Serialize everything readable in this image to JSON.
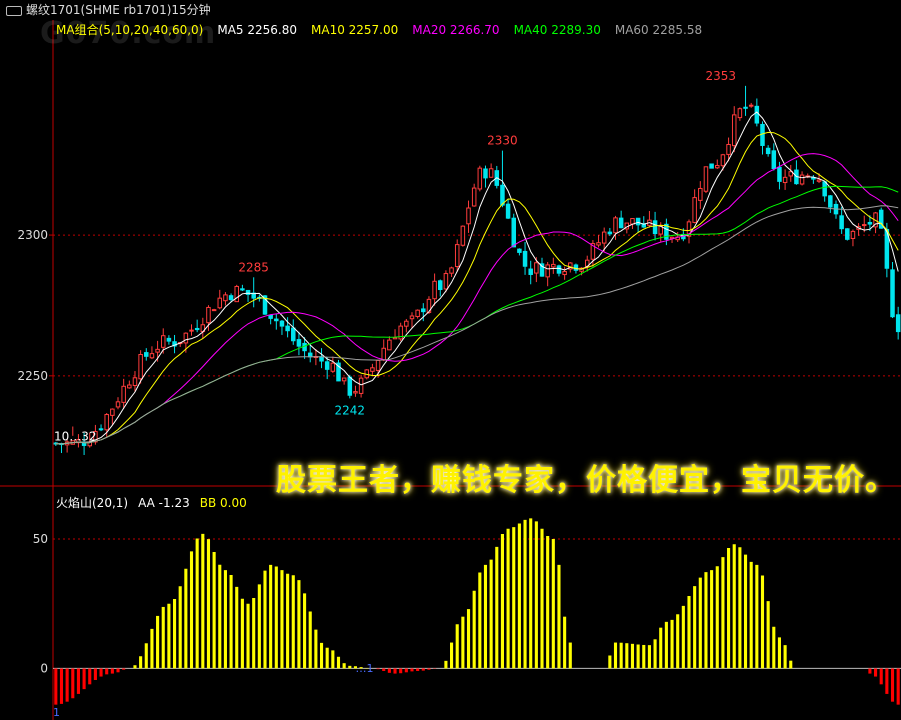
{
  "title": "螺纹1701(SHME rb1701)15分钟",
  "watermark": "G070.com",
  "banner": "股票王者，赚钱专家，价格便宜，宝贝无价。",
  "ma_legend": {
    "group": "MA组合(5,10,20,40,60,0)",
    "ma5": "MA5 2256.80",
    "ma10": "MA10 2257.00",
    "ma20": "MA20 2266.70",
    "ma40": "MA40 2289.30",
    "ma60": "MA60 2285.58"
  },
  "indicator_legend": {
    "name": "火焰山(20,1)",
    "aa": "AA  -1.23",
    "bb": "BB  0.00"
  },
  "colors": {
    "up": "#ff3c3c",
    "down": "#00e5ee",
    "ma5": "#ffffff",
    "ma10": "#ffff00",
    "ma20": "#ff00ff",
    "ma40": "#00ff00",
    "ma60": "#a0a0a0",
    "axis": "#c00000",
    "ind_pos": "#ffff00",
    "ind_neg": "#ff0000"
  },
  "chart_data": [
    {
      "type": "candlestick",
      "yticks": [
        2250,
        2300
      ],
      "ylim": [
        2213,
        2370
      ],
      "annotations": [
        {
          "label": "2353",
          "value": 2353,
          "kind": "high"
        },
        {
          "label": "2330",
          "value": 2330,
          "kind": "high"
        },
        {
          "label": "2285",
          "value": 2285,
          "kind": "high"
        },
        {
          "label": "2242",
          "value": 2242,
          "kind": "low"
        },
        {
          "label": "10…32",
          "value": 2232,
          "kind": "low"
        }
      ],
      "key_points": [
        {
          "bar": 3,
          "close": 2226
        },
        {
          "bar": 20,
          "close": 2262
        },
        {
          "bar": 32,
          "close": 2280
        },
        {
          "bar": 48,
          "close": 2255
        },
        {
          "bar": 52,
          "close": 2245
        },
        {
          "bar": 62,
          "close": 2268
        },
        {
          "bar": 68,
          "close": 2282
        },
        {
          "bar": 76,
          "close": 2323
        },
        {
          "bar": 84,
          "close": 2288
        },
        {
          "bar": 92,
          "close": 2290
        },
        {
          "bar": 100,
          "close": 2305
        },
        {
          "bar": 110,
          "close": 2300
        },
        {
          "bar": 116,
          "close": 2325
        },
        {
          "bar": 122,
          "close": 2345
        },
        {
          "bar": 128,
          "close": 2320
        },
        {
          "bar": 134,
          "close": 2322
        },
        {
          "bar": 140,
          "close": 2300
        },
        {
          "bar": 145,
          "close": 2305
        },
        {
          "bar": 149,
          "close": 2268
        }
      ],
      "series": [
        {
          "name": "MA5"
        },
        {
          "name": "MA10"
        },
        {
          "name": "MA20"
        },
        {
          "name": "MA40"
        },
        {
          "name": "MA60"
        }
      ]
    },
    {
      "type": "bar",
      "name": "火焰山(20,1)",
      "yticks": [
        50,
        0
      ],
      "ylim": [
        -18,
        62
      ],
      "key_points": [
        {
          "bar": 0,
          "value": -14
        },
        {
          "bar": 10,
          "value": -2
        },
        {
          "bar": 13,
          "value": 0
        },
        {
          "bar": 20,
          "value": 25
        },
        {
          "bar": 26,
          "value": 52
        },
        {
          "bar": 30,
          "value": 38
        },
        {
          "bar": 34,
          "value": 25
        },
        {
          "bar": 38,
          "value": 40
        },
        {
          "bar": 42,
          "value": 36
        },
        {
          "bar": 48,
          "value": 8
        },
        {
          "bar": 52,
          "value": 1
        },
        {
          "bar": 56,
          "value": 0
        },
        {
          "bar": 60,
          "value": -2
        },
        {
          "bar": 64,
          "value": -1
        },
        {
          "bar": 68,
          "value": 0
        },
        {
          "bar": 72,
          "value": 20
        },
        {
          "bar": 76,
          "value": 40
        },
        {
          "bar": 80,
          "value": 54
        },
        {
          "bar": 84,
          "value": 58
        },
        {
          "bar": 88,
          "value": 50
        },
        {
          "bar": 91,
          "value": 10
        },
        {
          "bar": 92,
          "value": 0
        },
        {
          "bar": 97,
          "value": 0
        },
        {
          "bar": 99,
          "value": 10
        },
        {
          "bar": 105,
          "value": 9
        },
        {
          "bar": 108,
          "value": 18
        },
        {
          "bar": 116,
          "value": 38
        },
        {
          "bar": 120,
          "value": 48
        },
        {
          "bar": 124,
          "value": 40
        },
        {
          "bar": 128,
          "value": 12
        },
        {
          "bar": 131,
          "value": 0
        },
        {
          "bar": 143,
          "value": 0
        },
        {
          "bar": 144,
          "value": -2
        },
        {
          "bar": 149,
          "value": -14
        }
      ],
      "annotations": [
        {
          "label": "1",
          "bar": 0
        },
        {
          "label": "…1",
          "bar": 53
        }
      ]
    }
  ]
}
